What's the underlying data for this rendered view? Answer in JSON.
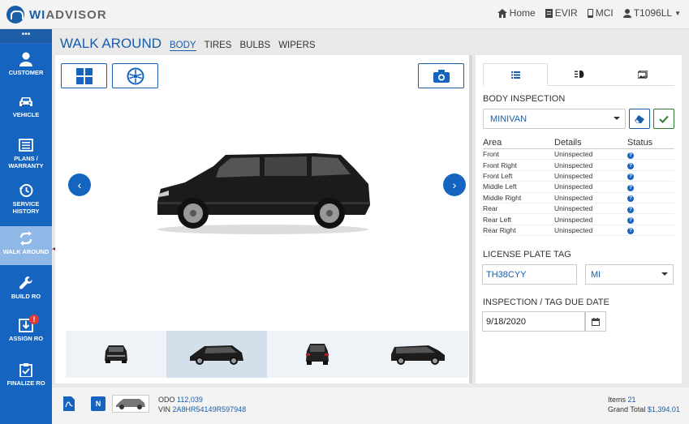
{
  "app": {
    "logo_prefix": "WI",
    "logo_suffix": "ADVISOR"
  },
  "topnav": {
    "home": "Home",
    "evir": "EVIR",
    "mci": "MCI",
    "user": "T1096LL"
  },
  "sidebar": {
    "dots": "•••",
    "items": [
      {
        "label": "CUSTOMER"
      },
      {
        "label": "VEHICLE"
      },
      {
        "label": "PLANS / WARRANTY"
      },
      {
        "label": "SERVICE HISTORY"
      },
      {
        "label": "WALK AROUND"
      },
      {
        "label": "BUILD RO"
      },
      {
        "label": "ASSIGN RO",
        "badge": "!"
      },
      {
        "label": "FINALIZE RO"
      }
    ]
  },
  "header": {
    "title": "WALK AROUND",
    "tabs": [
      "BODY",
      "TIRES",
      "BULBS",
      "WIPERS"
    ],
    "selected_tab": "BODY"
  },
  "inspection": {
    "title": "BODY INSPECTION",
    "vehicle_type": "MINIVAN",
    "columns": [
      "Area",
      "Details",
      "Status"
    ],
    "rows": [
      {
        "area": "Front",
        "details": "Uninspected"
      },
      {
        "area": "Front Right",
        "details": "Uninspected"
      },
      {
        "area": "Front Left",
        "details": "Uninspected"
      },
      {
        "area": "Middle Left",
        "details": "Uninspected"
      },
      {
        "area": "Middle Right",
        "details": "Uninspected"
      },
      {
        "area": "Rear",
        "details": "Uninspected"
      },
      {
        "area": "Rear Left",
        "details": "Uninspected"
      },
      {
        "area": "Rear Right",
        "details": "Uninspected"
      }
    ],
    "status_glyph": "?",
    "license_label": "LICENSE PLATE TAG",
    "license_value": "TH38CYY",
    "state_value": "MI",
    "due_label": "INSPECTION / TAG DUE DATE",
    "due_value": "9/18/2020"
  },
  "footer": {
    "badge_n": "N",
    "odo_label": "ODO",
    "odo_value": "112,039",
    "vin_label": "VIN",
    "vin_value": "2A8HR54149R597948",
    "items_label": "Items",
    "items_value": "21",
    "total_label": "Grand Total",
    "total_value": "$1,394.01"
  },
  "colors": {
    "brand": "#1565c0",
    "accent_red": "#8a1c33",
    "active_sidebar": "#90b8e6"
  }
}
